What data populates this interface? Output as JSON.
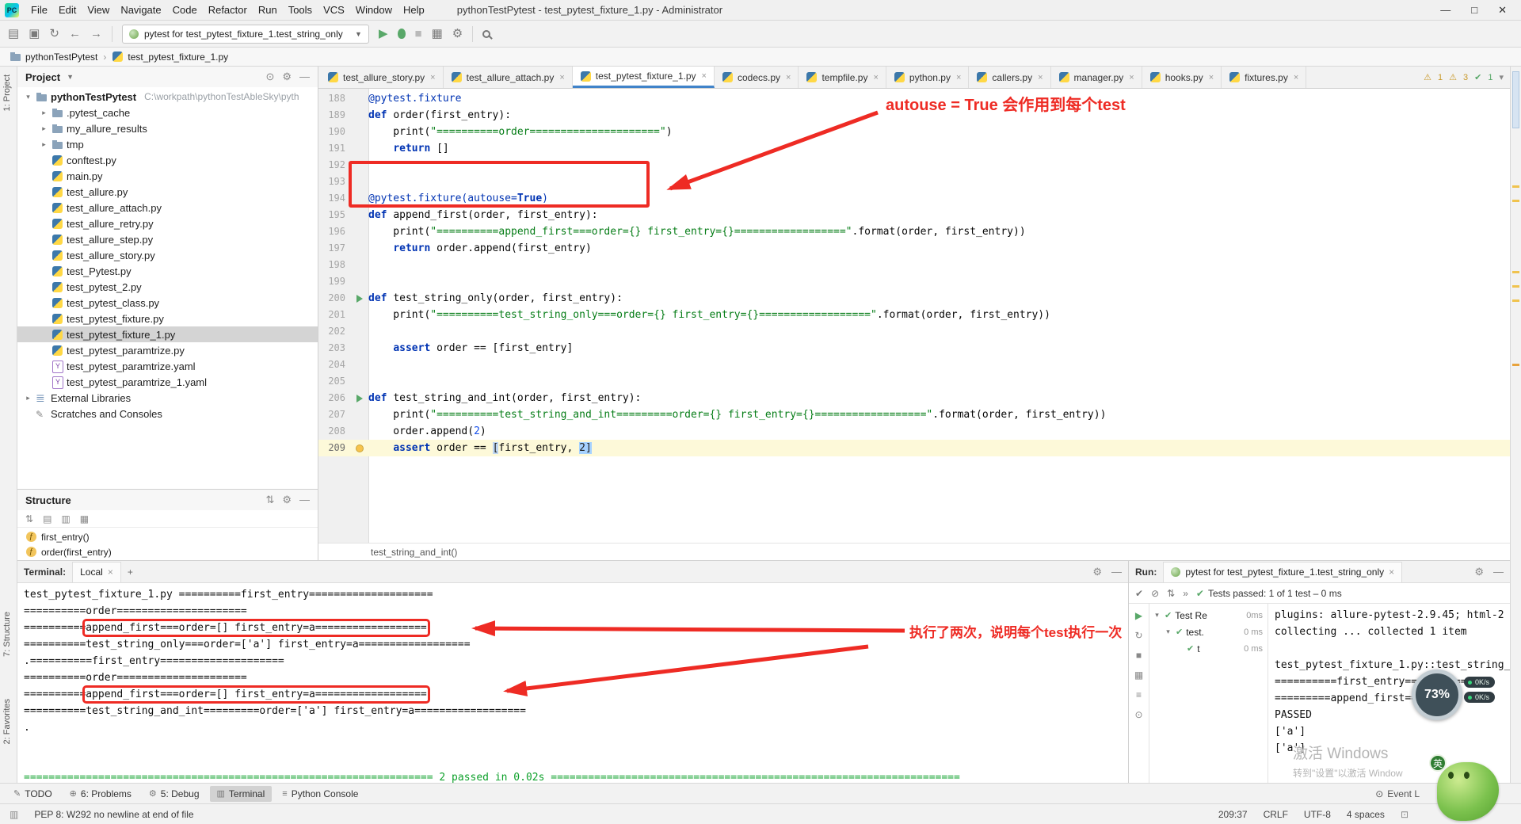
{
  "window": {
    "title": "pythonTestPytest - test_pytest_fixture_1.py - Administrator",
    "menus": [
      "File",
      "Edit",
      "View",
      "Navigate",
      "Code",
      "Refactor",
      "Run",
      "Tools",
      "VCS",
      "Window",
      "Help"
    ]
  },
  "toolbar": {
    "run_config": "pytest for test_pytest_fixture_1.test_string_only"
  },
  "breadcrumb": [
    "pythonTestPytest",
    "test_pytest_fixture_1.py"
  ],
  "stripes": {
    "project": "1: Project",
    "structure": "7: Structure",
    "favorites": "2: Favorites"
  },
  "inspections": {
    "warnings": "1",
    "weak_warnings": "3",
    "ok": "1"
  },
  "project": {
    "header": "Project",
    "items": [
      {
        "arrow": "▾",
        "icon": "folder",
        "label": "pythonTestPytest",
        "path": "C:\\workpath\\pythonTestAbleSky\\pyth",
        "cls": "root"
      },
      {
        "arrow": "▸",
        "icon": "folder",
        "label": ".pytest_cache",
        "cls": "ind1"
      },
      {
        "arrow": "▸",
        "icon": "folder",
        "label": "my_allure_results",
        "cls": "ind1"
      },
      {
        "arrow": "▸",
        "icon": "folder",
        "label": "tmp",
        "cls": "ind1"
      },
      {
        "icon": "py",
        "label": "conftest.py",
        "cls": "ind1"
      },
      {
        "icon": "py",
        "label": "main.py",
        "cls": "ind1"
      },
      {
        "icon": "py",
        "label": "test_allure.py",
        "cls": "ind1"
      },
      {
        "icon": "py",
        "label": "test_allure_attach.py",
        "cls": "ind1"
      },
      {
        "icon": "py",
        "label": "test_allure_retry.py",
        "cls": "ind1"
      },
      {
        "icon": "py",
        "label": "test_allure_step.py",
        "cls": "ind1"
      },
      {
        "icon": "py",
        "label": "test_allure_story.py",
        "cls": "ind1"
      },
      {
        "icon": "py",
        "label": "test_Pytest.py",
        "cls": "ind1"
      },
      {
        "icon": "py",
        "label": "test_pytest_2.py",
        "cls": "ind1"
      },
      {
        "icon": "py",
        "label": "test_pytest_class.py",
        "cls": "ind1"
      },
      {
        "icon": "py",
        "label": "test_pytest_fixture.py",
        "cls": "ind1"
      },
      {
        "icon": "py",
        "label": "test_pytest_fixture_1.py",
        "cls": "ind1 selected"
      },
      {
        "icon": "py",
        "label": "test_pytest_paramtrize.py",
        "cls": "ind1"
      },
      {
        "icon": "yaml",
        "label": "test_pytest_paramtrize.yaml",
        "cls": "ind1"
      },
      {
        "icon": "yaml",
        "label": "test_pytest_paramtrize_1.yaml",
        "cls": "ind1"
      },
      {
        "arrow": "▸",
        "icon": "lib",
        "label": "External Libraries",
        "cls": ""
      },
      {
        "icon": "scratch",
        "label": "Scratches and Consoles",
        "cls": ""
      }
    ]
  },
  "structure": {
    "header": "Structure",
    "items": [
      {
        "icon": "func",
        "label": "first_entry()"
      },
      {
        "icon": "func",
        "label": "order(first_entry)"
      }
    ]
  },
  "tabs": [
    {
      "label": "test_allure_story.py",
      "cls": ""
    },
    {
      "label": "test_allure_attach.py",
      "cls": ""
    },
    {
      "label": "test_pytest_fixture_1.py",
      "cls": "active"
    },
    {
      "label": "codecs.py",
      "cls": ""
    },
    {
      "label": "tempfile.py",
      "cls": ""
    },
    {
      "label": "python.py",
      "cls": ""
    },
    {
      "label": "callers.py",
      "cls": ""
    },
    {
      "label": "manager.py",
      "cls": ""
    },
    {
      "label": "hooks.py",
      "cls": ""
    },
    {
      "label": "fixtures.py",
      "cls": ""
    }
  ],
  "editor": {
    "context": "test_string_and_int()",
    "lines": [
      {
        "num": "188",
        "tokens": [
          {
            "t": "@pytest.fixture",
            "c": "d"
          }
        ]
      },
      {
        "num": "189",
        "tokens": [
          {
            "t": "def ",
            "c": "k"
          },
          {
            "t": "order(first_entry):",
            "c": "p"
          }
        ]
      },
      {
        "num": "190",
        "tokens": [
          {
            "t": "    print(",
            "c": "p"
          },
          {
            "t": "\"==========order=====================\"",
            "c": "s"
          },
          {
            "t": ")",
            "c": "p"
          }
        ]
      },
      {
        "num": "191",
        "tokens": [
          {
            "t": "    ",
            "c": "p"
          },
          {
            "t": "return ",
            "c": "k"
          },
          {
            "t": "[]",
            "c": "p"
          }
        ]
      },
      {
        "num": "192",
        "tokens": []
      },
      {
        "num": "193",
        "tokens": []
      },
      {
        "num": "194",
        "tokens": [
          {
            "t": "@pytest.fixture(autouse=",
            "c": "d"
          },
          {
            "t": "True",
            "c": "k"
          },
          {
            "t": ")",
            "c": "d"
          }
        ]
      },
      {
        "num": "195",
        "tokens": [
          {
            "t": "def ",
            "c": "k"
          },
          {
            "t": "append_first(order, first_entry):",
            "c": "p"
          }
        ]
      },
      {
        "num": "196",
        "tokens": [
          {
            "t": "    print(",
            "c": "p"
          },
          {
            "t": "\"==========append_first===order={} first_entry={}==================\"",
            "c": "s"
          },
          {
            "t": ".format(order, first_entry))",
            "c": "p"
          }
        ]
      },
      {
        "num": "197",
        "tokens": [
          {
            "t": "    ",
            "c": "p"
          },
          {
            "t": "return ",
            "c": "k"
          },
          {
            "t": "order.append(first_entry)",
            "c": "p"
          }
        ]
      },
      {
        "num": "198",
        "tokens": []
      },
      {
        "num": "199",
        "tokens": []
      },
      {
        "num": "200",
        "run": true,
        "tokens": [
          {
            "t": "def ",
            "c": "k"
          },
          {
            "t": "test_string_only(order, first_entry):",
            "c": "p"
          }
        ]
      },
      {
        "num": "201",
        "tokens": [
          {
            "t": "    print(",
            "c": "p"
          },
          {
            "t": "\"==========test_string_only===order={} first_entry={}==================\"",
            "c": "s"
          },
          {
            "t": ".format(order, first_entry))",
            "c": "p"
          }
        ]
      },
      {
        "num": "202",
        "tokens": []
      },
      {
        "num": "203",
        "tokens": [
          {
            "t": "    ",
            "c": "p"
          },
          {
            "t": "assert ",
            "c": "k"
          },
          {
            "t": "order == [first_entry]",
            "c": "p"
          }
        ]
      },
      {
        "num": "204",
        "tokens": []
      },
      {
        "num": "205",
        "tokens": []
      },
      {
        "num": "206",
        "run": true,
        "tokens": [
          {
            "t": "def ",
            "c": "k"
          },
          {
            "t": "test_string_and_int(order, first_entry):",
            "c": "p"
          }
        ]
      },
      {
        "num": "207",
        "tokens": [
          {
            "t": "    print(",
            "c": "p"
          },
          {
            "t": "\"==========test_string_and_int=========order={} first_entry={}==================\"",
            "c": "s"
          },
          {
            "t": ".format(order, first_entry))",
            "c": "p"
          }
        ]
      },
      {
        "num": "208",
        "tokens": [
          {
            "t": "    order.append(",
            "c": "p"
          },
          {
            "t": "2",
            "c": "n"
          },
          {
            "t": ")",
            "c": "p"
          }
        ]
      },
      {
        "num": "209",
        "cls": "cur",
        "bulb": true,
        "tokens": [
          {
            "t": "    ",
            "c": "p"
          },
          {
            "t": "assert ",
            "c": "k"
          },
          {
            "t": "order == ",
            "c": "p"
          },
          {
            "t": "[",
            "c": "br"
          },
          {
            "t": "first_entry, ",
            "c": "p"
          },
          {
            "t": "2]",
            "c": "sel"
          }
        ]
      }
    ]
  },
  "annotations": {
    "editor_note": "autouse = True 会作用到每个test",
    "terminal_note": "执行了两次，说明每个test执行一次"
  },
  "terminal": {
    "label": "Terminal:",
    "tab": "Local",
    "add": "+",
    "lines": [
      {
        "pre": "test_pytest_fixture_1.py ==========first_entry====================",
        "cls": ""
      },
      {
        "pre": "==========order=====================",
        "cls": ""
      },
      {
        "pre": "==========",
        "boxed": "append_first===order=[] first_entry=a==================",
        "cls": ""
      },
      {
        "pre": "==========test_string_only===order=['a'] first_entry=a==================",
        "cls": ""
      },
      {
        "pre": ".==========first_entry====================",
        "cls": ""
      },
      {
        "pre": "==========order=====================",
        "cls": ""
      },
      {
        "pre": "==========",
        "boxed": "append_first===order=[] first_entry=a==================",
        "cls": ""
      },
      {
        "pre": "==========test_string_and_int=========order=['a'] first_entry=a==================",
        "cls": ""
      },
      {
        "pre": ".",
        "cls": ""
      },
      {
        "pre": "",
        "cls": ""
      },
      {
        "pre": "",
        "cls": ""
      },
      {
        "pre": "================================================================== 2 passed in 0.02s ==================================================================",
        "cls": "green"
      }
    ]
  },
  "run": {
    "label": "Run:",
    "tab": "pytest for test_pytest_fixture_1.test_string_only",
    "status": "Tests passed: 1 of 1 test – 0 ms",
    "tree": [
      {
        "arrow": "▾",
        "label": "Test Re",
        "time": "0ms",
        "cls": ""
      },
      {
        "arrow": "▾",
        "label": "test.",
        "time": "0 ms",
        "cls": "ind1"
      },
      {
        "arrow": "",
        "label": "t",
        "time": "0 ms",
        "cls": "ind2"
      }
    ],
    "console": [
      "plugins: allure-pytest-2.9.45; html-2",
      "collecting ... collected 1 item",
      "",
      "test_pytest_fixture_1.py::test_string_",
      "==========first_entry==========",
      "=========append_first===orde",
      "PASSED",
      "['a']",
      "['a']"
    ]
  },
  "watermark": {
    "line1": "激活 Windows",
    "line2": "转到\"设置\"以激活 Window"
  },
  "overlays": {
    "cpu": "73%",
    "net_up": "0K/s",
    "net_down": "0K/s",
    "ime": "英"
  },
  "bottombar": {
    "items": [
      {
        "label": "TODO",
        "icon": "✎",
        "cls": ""
      },
      {
        "label": "6: Problems",
        "icon": "⊕",
        "cls": ""
      },
      {
        "label": "5: Debug",
        "icon": "⚙",
        "cls": ""
      },
      {
        "label": "Terminal",
        "icon": "▥",
        "cls": "active"
      },
      {
        "label": "Python Console",
        "icon": "≡",
        "cls": ""
      }
    ],
    "right": "Event L"
  },
  "statusbar": {
    "message": "PEP 8: W292 no newline at end of file",
    "caret": "209:37",
    "line_sep": "CRLF",
    "encoding": "UTF-8",
    "indent": "4 spaces"
  }
}
